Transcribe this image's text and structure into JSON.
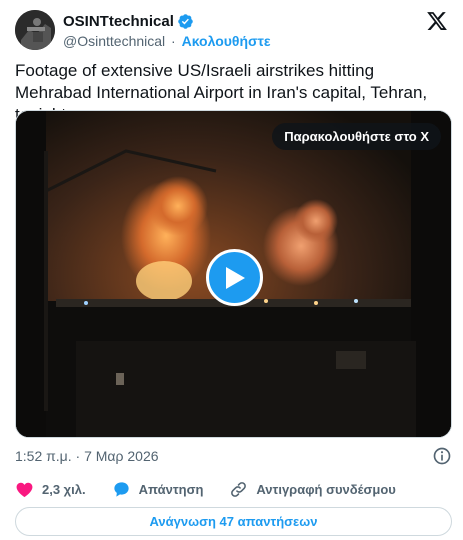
{
  "header": {
    "display_name": "OSINTtechnical",
    "handle": "@Osinttechnical",
    "separator": "·",
    "follow_label": "Ακολουθήστε"
  },
  "tweet": {
    "text": "Footage of extensive US/Israeli airstrikes hitting Mehrabad International Airport in Iran's capital, Tehran, tonight."
  },
  "media": {
    "watch_label": "Παρακολουθήστε στο X"
  },
  "meta": {
    "timestamp": "1:52 π.μ. · 7 Μαρ 2026"
  },
  "actions": {
    "likes": "2,3 χιλ.",
    "reply_label": "Απάντηση",
    "copy_link_label": "Αντιγραφή συνδέσμου"
  },
  "replies_button": "Ανάγνωση 47 απαντήσεων",
  "colors": {
    "accent": "#1d9bf0",
    "like": "#f91880",
    "secondary_text": "#536471"
  }
}
